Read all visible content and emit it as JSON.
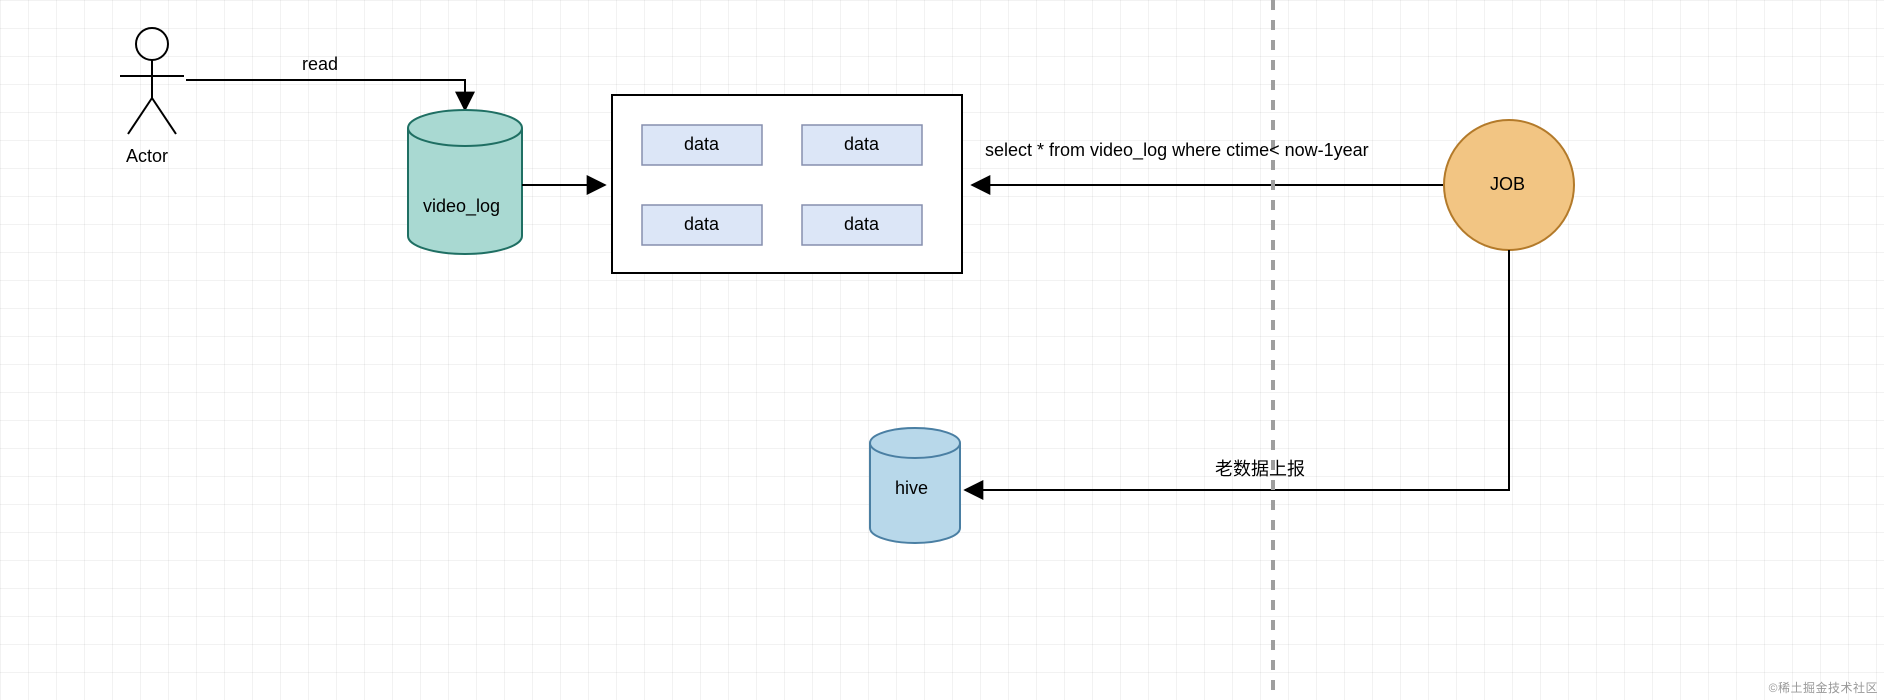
{
  "actor": {
    "label": "Actor"
  },
  "edges": {
    "read": "read",
    "query": "select * from video_log where ctime< now-1year",
    "report": "老数据上报"
  },
  "db": {
    "video_log": "video_log",
    "hive": "hive"
  },
  "box": {
    "cells": [
      "data",
      "data",
      "data",
      "data"
    ]
  },
  "job": {
    "label": "JOB"
  },
  "watermark": "©稀土掘金技术社区",
  "colors": {
    "videoLogFill": "#a9d9d2",
    "videoLogStroke": "#1f6f63",
    "hiveFill": "#b8d8ea",
    "hiveStroke": "#4a7fa3",
    "cellFill": "#dce6f7",
    "cellStroke": "#868fad",
    "jobFill": "#f2c583",
    "jobStroke": "#b37a2a",
    "line": "#000000"
  }
}
